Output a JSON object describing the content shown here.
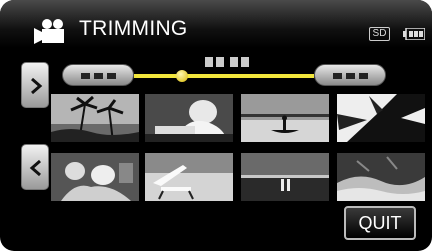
{
  "header": {
    "title": "TRIMMING",
    "mode_icon": "movie-camera-icon",
    "media_badge": "SD",
    "battery_icon": "battery-icon"
  },
  "navigation": {
    "next_icon": "chevron-right-icon",
    "prev_icon": "chevron-left-icon"
  },
  "trim": {
    "start_marker_icon": "trim-start-marker-icon",
    "end_marker_icon": "trim-end-marker-icon",
    "handle_icon": "playhead-icon"
  },
  "thumbnails": [
    {
      "name": "palm-trees-beach"
    },
    {
      "name": "woman-reading"
    },
    {
      "name": "pier-canoe-silhouette"
    },
    {
      "name": "palm-leaves-silhouette"
    },
    {
      "name": "people-in-water"
    },
    {
      "name": "beach-lounge-chair"
    },
    {
      "name": "couple-on-shoreline"
    },
    {
      "name": "waves-on-shore"
    }
  ],
  "footer": {
    "quit_label": "QUIT"
  }
}
